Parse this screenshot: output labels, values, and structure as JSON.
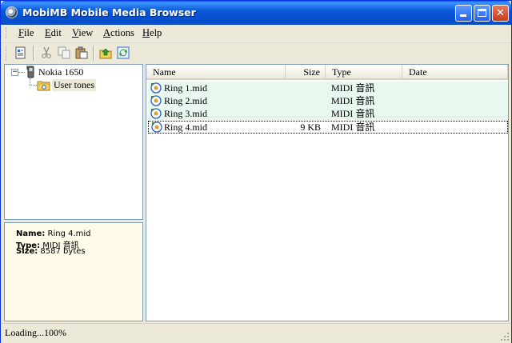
{
  "window": {
    "title": "MobiMB Mobile Media Browser"
  },
  "menu": [
    {
      "label": "File",
      "accel": "F"
    },
    {
      "label": "Edit",
      "accel": "E"
    },
    {
      "label": "View",
      "accel": "V"
    },
    {
      "label": "Actions",
      "accel": "A"
    },
    {
      "label": "Help",
      "accel": "H"
    }
  ],
  "toolbar": {
    "buttons": [
      "properties-icon",
      "cut-icon",
      "copy-icon",
      "paste-icon",
      "upload-icon",
      "refresh-icon"
    ]
  },
  "tree": {
    "device": "Nokia 1650",
    "expander": "⊟",
    "folder": "User tones"
  },
  "info": {
    "name_label": "Name:",
    "name_value": "Ring 4.mid",
    "type_label": "Type:",
    "type_value": "MIDI 音訊",
    "size_label": "Size:",
    "size_value": "8587 bytes"
  },
  "list": {
    "columns": [
      "Name",
      "Size",
      "Type",
      "Date"
    ],
    "rows": [
      {
        "name": "Ring 1.mid",
        "size": "",
        "type": "MIDI 音訊",
        "date": ""
      },
      {
        "name": "Ring 2.mid",
        "size": "",
        "type": "MIDI 音訊",
        "date": ""
      },
      {
        "name": "Ring 3.mid",
        "size": "",
        "type": "MIDI 音訊",
        "date": ""
      },
      {
        "name": "Ring 4.mid",
        "size": "9 KB",
        "type": "MIDI 音訊",
        "date": ""
      }
    ],
    "selected_index": 3
  },
  "status": {
    "text": "Loading...100%"
  },
  "colors": {
    "titlebar": "#0a5fe0",
    "row_tint": "#e8f8ee",
    "info_bg": "#fffbe8"
  }
}
